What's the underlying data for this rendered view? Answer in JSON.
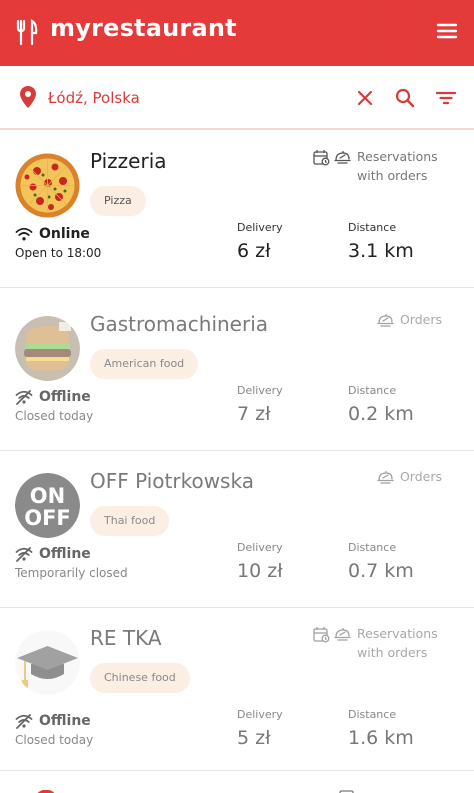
{
  "app": {
    "name": "myrestaurant"
  },
  "search": {
    "location": "Łódź, Polska"
  },
  "colors": {
    "accent": "#e53935",
    "tag_bg": "#fbeee3"
  },
  "restaurants": [
    {
      "name": "Pizzeria",
      "tag": "Pizza",
      "service": "Reservations with orders",
      "service_line1": "Reservations",
      "service_line2": "with orders",
      "status": "Online",
      "hours": "Open to 18:00",
      "delivery_label": "Delivery",
      "delivery": "6 zł",
      "distance_label": "Distance",
      "distance": "3.1 km"
    },
    {
      "name": "Gastromachineria",
      "tag": "American food",
      "service": "Orders",
      "status": "Offline",
      "hours": "Closed today",
      "delivery_label": "Delivery",
      "delivery": "7 zł",
      "distance_label": "Distance",
      "distance": "0.2 km"
    },
    {
      "name": "OFF Piotrkowska",
      "tag": "Thai food",
      "service": "Orders",
      "status": "Offline",
      "hours": "Temporarily closed",
      "delivery_label": "Delivery",
      "delivery": "10 zł",
      "distance_label": "Distance",
      "distance": "0.7 km",
      "logo_text_top": "ON",
      "logo_text_bottom": "OFF"
    },
    {
      "name": "RE TKA",
      "tag": "Chinese food",
      "service_line1": "Reservations",
      "service_line2": "with orders",
      "status": "Offline",
      "hours": "Closed today",
      "delivery_label": "Delivery",
      "delivery": "5 zł",
      "distance_label": "Distance",
      "distance": "1.6 km"
    }
  ]
}
